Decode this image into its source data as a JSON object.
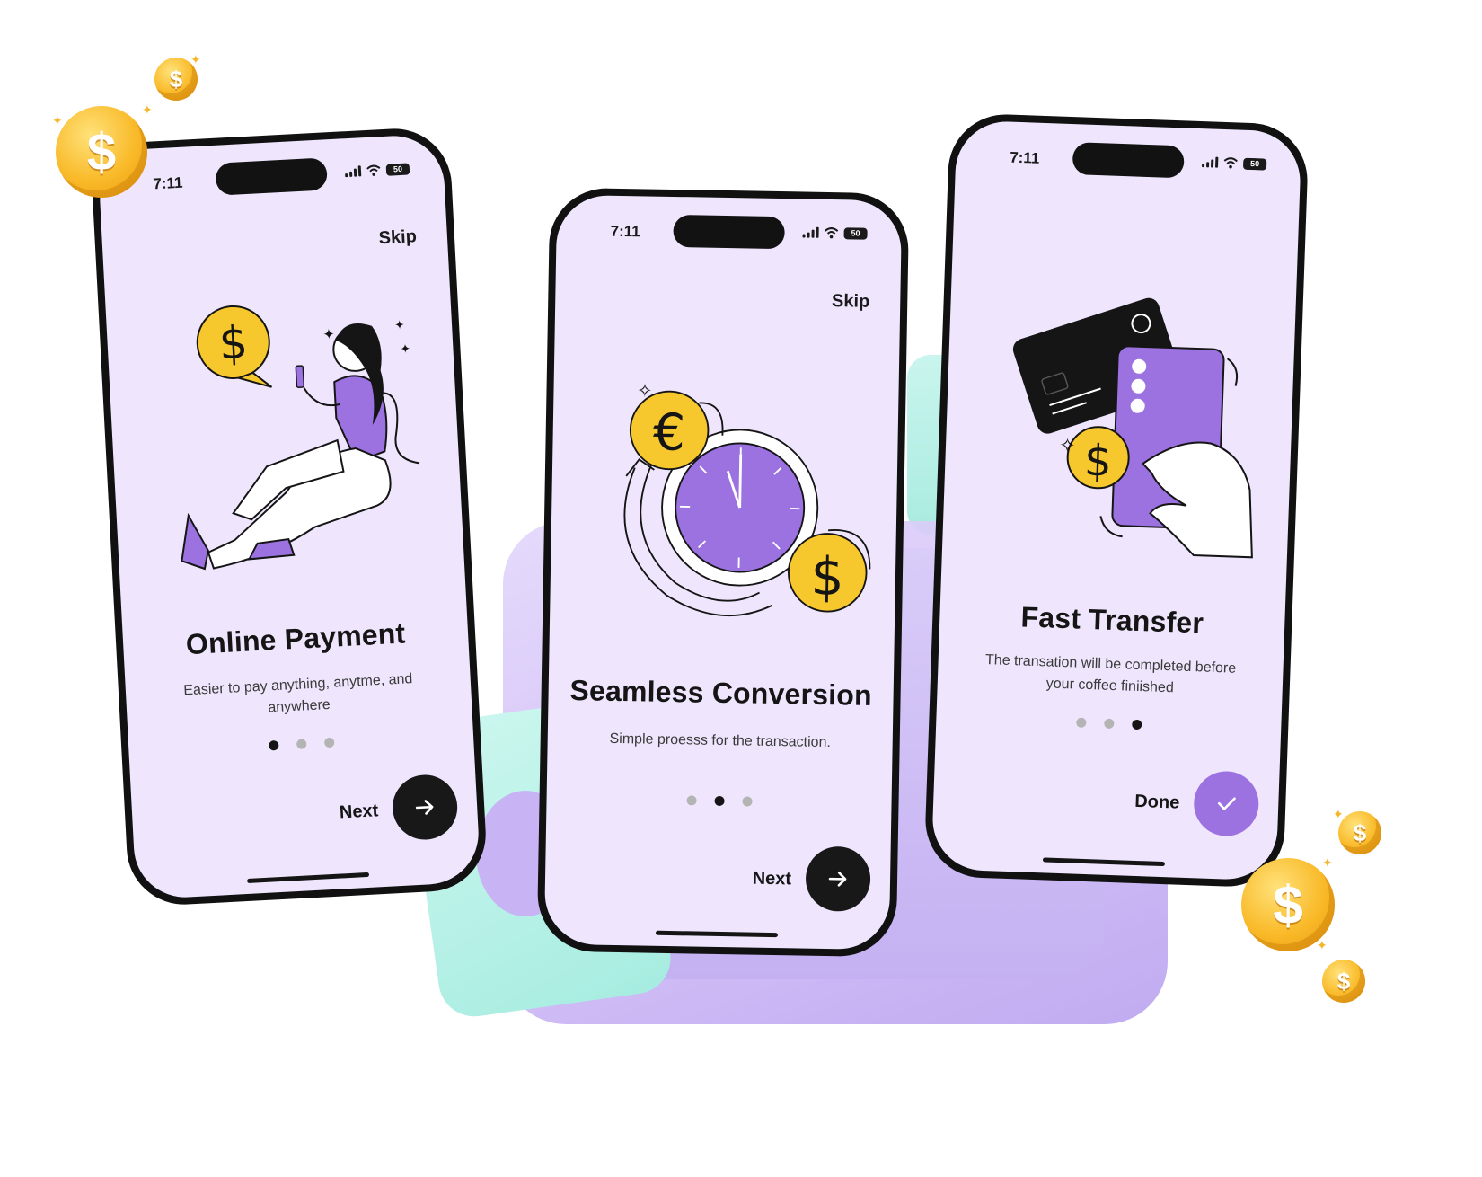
{
  "phones": [
    {
      "status": {
        "time": "7:11",
        "battery": "50"
      },
      "skip": "Skip",
      "title": "Online Payment",
      "subtitle": "Easier to pay anything, anytme, and anywhere",
      "active_dot": 0,
      "action_label": "Next",
      "action_icon": "arrow-right-icon"
    },
    {
      "status": {
        "time": "7:11",
        "battery": "50"
      },
      "skip": "Skip",
      "title": "Seamless Conversion",
      "subtitle": "Simple proesss for the transaction.",
      "active_dot": 1,
      "action_label": "Next",
      "action_icon": "arrow-right-icon"
    },
    {
      "status": {
        "time": "7:11",
        "battery": "50"
      },
      "title": "Fast Transfer",
      "subtitle": "The transation will be completed before your coffee finiished",
      "active_dot": 2,
      "action_label": "Done",
      "action_icon": "check-icon"
    }
  ],
  "coin_symbol": "$",
  "colors": {
    "accent": "#9b72e0",
    "screen": "#efe6fd",
    "coin": "#f9b928",
    "yellow": "#f7c82d",
    "dark": "#151515"
  }
}
